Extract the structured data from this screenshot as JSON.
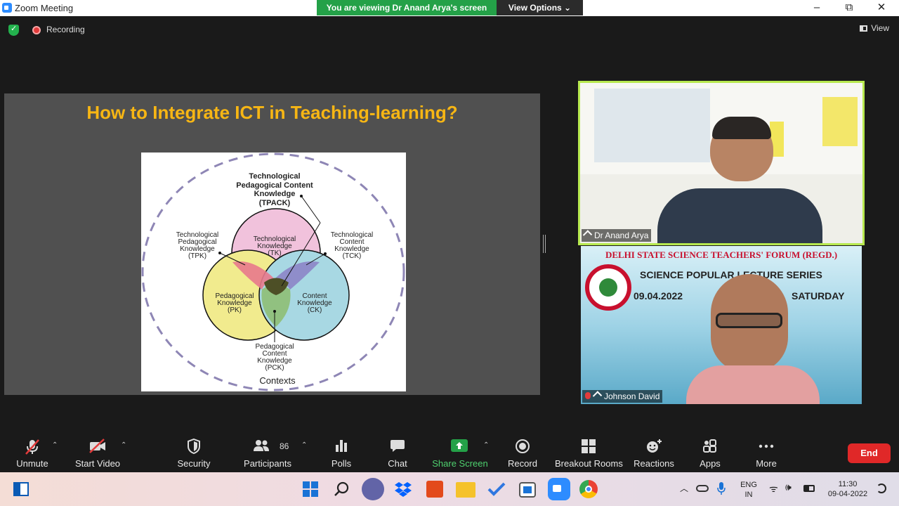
{
  "window": {
    "title": "Zoom Meeting",
    "minimize": "–",
    "maximize": "⧉",
    "close": "✕"
  },
  "share_banner": {
    "viewing": "You are viewing Dr Anand Arya's screen",
    "view_options": "View Options ⌄"
  },
  "meeting_bar": {
    "recording": "Recording",
    "view": "View"
  },
  "slide": {
    "title": "How to Integrate ICT in Teaching-learning?",
    "diagram": {
      "tpack": [
        "Technological",
        "Pedagogical Content",
        "Knowledge",
        "(TPACK)"
      ],
      "tpk": [
        "Technological",
        "Pedagogical",
        "Knowledge",
        "(TPK)"
      ],
      "tck": [
        "Technological",
        "Content",
        "Knowledge",
        "(TCK)"
      ],
      "tk": [
        "Technological",
        "Knowledge",
        "(TK)"
      ],
      "pk": [
        "Pedagogical",
        "Knowledge",
        "(PK)"
      ],
      "ck": [
        "Content",
        "Knowledge",
        "(CK)"
      ],
      "pck": [
        "Pedagogical",
        "Content",
        "Knowledge",
        "(PCK)"
      ],
      "contexts": "Contexts"
    }
  },
  "participants_video": [
    {
      "name": "Dr Anand Arya"
    },
    {
      "name": "Johnson David",
      "banner_line1": "DELHI STATE SCIENCE TEACHERS' FORUM (REGD.)",
      "banner_line2": "SCIENCE POPULAR LECTURE SERIES",
      "date": "09.04.2022",
      "day": "SATURDAY"
    }
  ],
  "toolbar": {
    "unmute": "Unmute",
    "start_video": "Start Video",
    "security": "Security",
    "participants": "Participants",
    "participants_count": "86",
    "polls": "Polls",
    "chat": "Chat",
    "share_screen": "Share Screen",
    "record": "Record",
    "breakout_rooms": "Breakout Rooms",
    "reactions": "Reactions",
    "apps": "Apps",
    "more": "More",
    "end": "End"
  },
  "taskbar": {
    "lang1": "ENG",
    "lang2": "IN",
    "time": "11:30",
    "date": "09-04-2022"
  },
  "colors": {
    "share_green": "#24a148",
    "end_red": "#e02828",
    "slide_title": "#f7b614",
    "active_speaker": "#b7e94f"
  }
}
